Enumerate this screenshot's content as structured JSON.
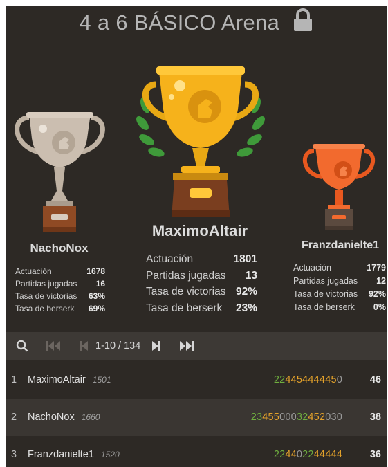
{
  "title": "4 a 6 BÁSICO Arena",
  "podium": {
    "first": {
      "name": "MaximoAltair",
      "stats": [
        {
          "label": "Actuación",
          "value": "1801"
        },
        {
          "label": "Partidas jugadas",
          "value": "13"
        },
        {
          "label": "Tasa de victorias",
          "value": "92%"
        },
        {
          "label": "Tasa de berserk",
          "value": "23%"
        }
      ]
    },
    "second": {
      "name": "NachoNox",
      "stats": [
        {
          "label": "Actuación",
          "value": "1678"
        },
        {
          "label": "Partidas jugadas",
          "value": "16"
        },
        {
          "label": "Tasa de victorias",
          "value": "63%"
        },
        {
          "label": "Tasa de berserk",
          "value": "69%"
        }
      ]
    },
    "third": {
      "name": "Franzdanielte1",
      "stats": [
        {
          "label": "Actuación",
          "value": "1779"
        },
        {
          "label": "Partidas jugadas",
          "value": "12"
        },
        {
          "label": "Tasa de victorias",
          "value": "92%"
        },
        {
          "label": "Tasa de berserk",
          "value": "0%"
        }
      ]
    }
  },
  "pager": {
    "range": "1-10 / 134"
  },
  "standings": [
    {
      "rank": "1",
      "name": "MaximoAltair",
      "rating": "1501",
      "sheet": [
        [
          "22",
          "g"
        ],
        [
          "44544444",
          "o"
        ],
        [
          "5",
          "o"
        ],
        [
          "0",
          "n"
        ]
      ],
      "score": "46"
    },
    {
      "rank": "2",
      "name": "NachoNox",
      "rating": "1660",
      "sheet": [
        [
          "23",
          "g"
        ],
        [
          "455",
          "o"
        ],
        [
          "000",
          "n"
        ],
        [
          "32",
          "g"
        ],
        [
          "452",
          "o"
        ],
        [
          "030",
          "n"
        ]
      ],
      "score": "38"
    },
    {
      "rank": "3",
      "name": "Franzdanielte1",
      "rating": "1520",
      "sheet": [
        [
          "22",
          "g"
        ],
        [
          "44",
          "o"
        ],
        [
          "0",
          "n"
        ],
        [
          "22",
          "g"
        ],
        [
          "44444",
          "o"
        ]
      ],
      "score": "36"
    }
  ],
  "colors": {
    "background": "#2d2925",
    "gold": "#f6b21b",
    "silver": "#c9bcad",
    "bronze": "#f26a2e",
    "green": "#6fae3f",
    "orange": "#e3a12a"
  }
}
